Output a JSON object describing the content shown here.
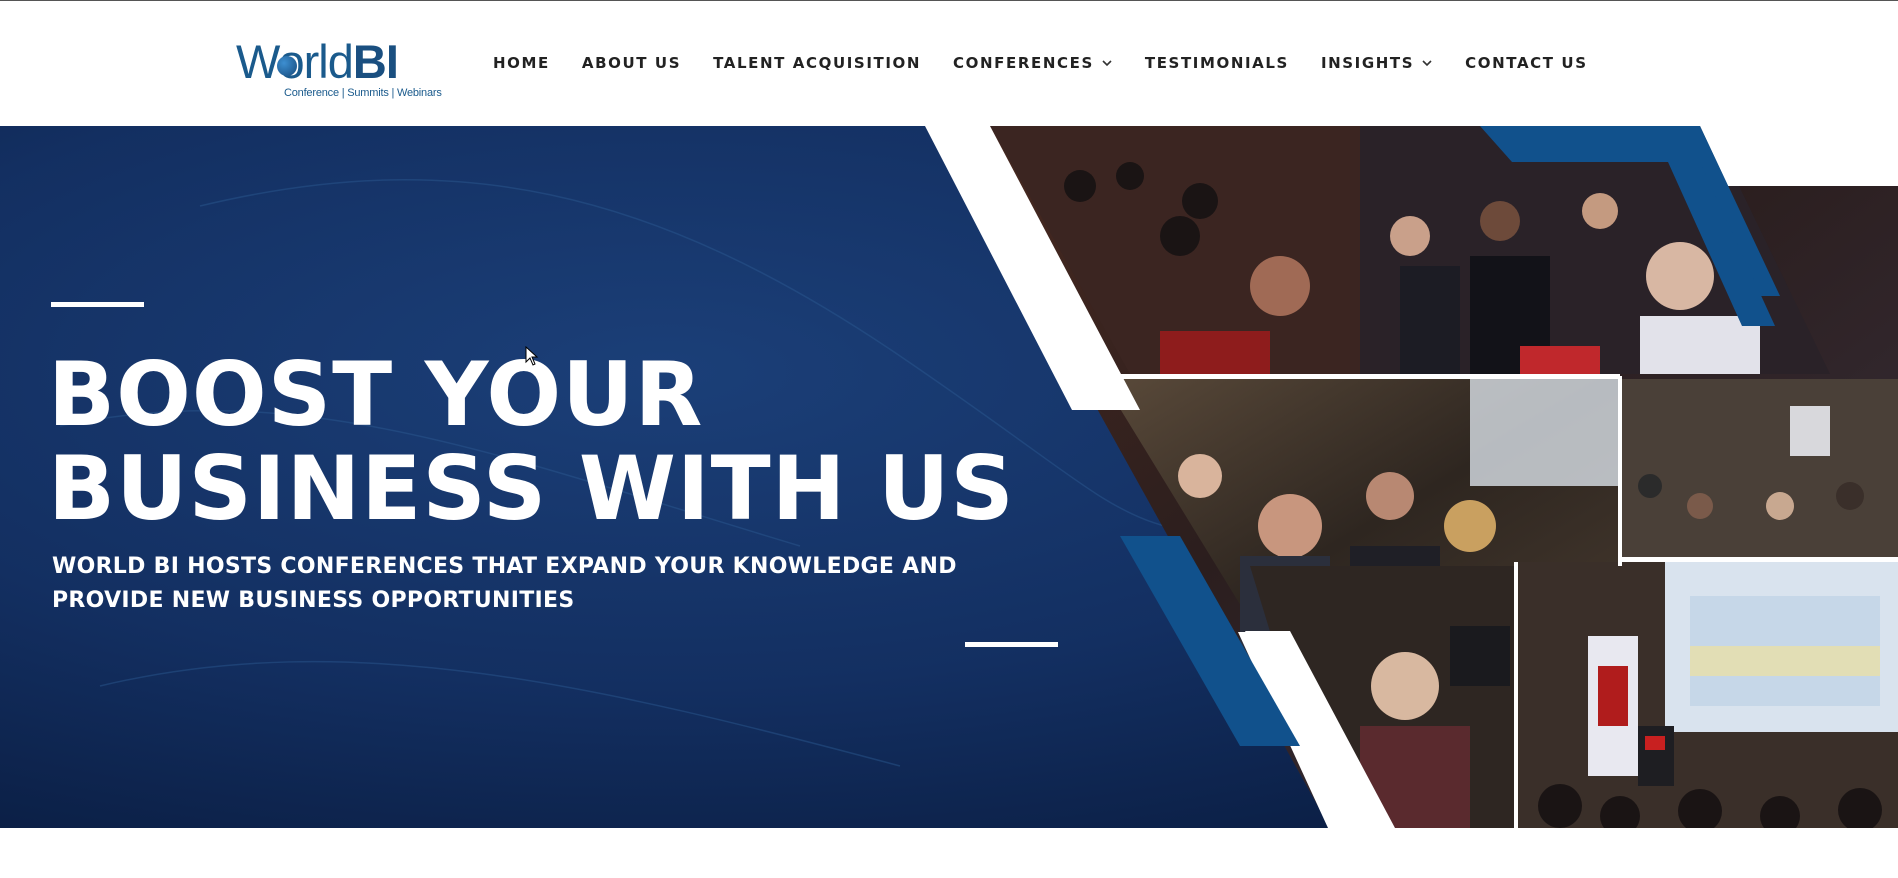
{
  "brand": {
    "name_regular": "World",
    "name_bold": "BI",
    "tagline": "Conference | Summits | Webinars",
    "color": "#1a5a8c"
  },
  "nav": {
    "items": [
      {
        "label": "HOME",
        "has_dropdown": false
      },
      {
        "label": "ABOUT US",
        "has_dropdown": false
      },
      {
        "label": "TALENT ACQUISITION",
        "has_dropdown": false
      },
      {
        "label": "CONFERENCES",
        "has_dropdown": true
      },
      {
        "label": "TESTIMONIALS",
        "has_dropdown": false
      },
      {
        "label": "INSIGHTS",
        "has_dropdown": true
      },
      {
        "label": "CONTACT US",
        "has_dropdown": false
      }
    ]
  },
  "hero": {
    "headline_line1": "BOOST YOUR",
    "headline_line2": "BUSINESS WITH US",
    "subline_line1": "WORLD BI HOSTS CONFERENCES THAT EXPAND YOUR KNOWLEDGE AND",
    "subline_line2": "PROVIDE NEW BUSINESS OPPORTUNITIES",
    "bg_color": "#122f60",
    "accent_color": "#11518c"
  }
}
